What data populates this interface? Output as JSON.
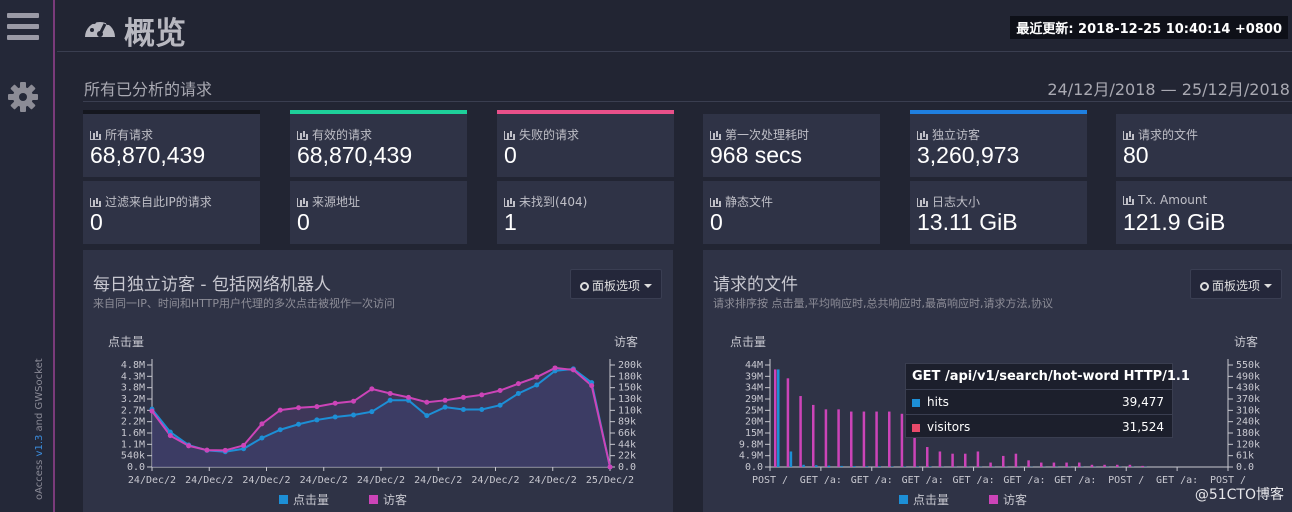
{
  "app": {
    "title": "概览",
    "last_updated": "最近更新: 2018-12-25 10:40:14 +0800"
  },
  "sidebar": {
    "credit_prefix": "oAccess",
    "credit_version": "v1.3",
    "credit_and": " and ",
    "credit_suffix": "GWSocket"
  },
  "overview": {
    "section_title": "所有已分析的请求",
    "date_range": "24/12月/2018 — 25/12月/2018"
  },
  "cards": [
    {
      "label": "所有请求",
      "value": "68,870,439"
    },
    {
      "label": "有效的请求",
      "value": "68,870,439"
    },
    {
      "label": "失败的请求",
      "value": "0"
    },
    {
      "label": "第一次处理耗时",
      "value": "968 secs"
    },
    {
      "label": "独立访客",
      "value": "3,260,973"
    },
    {
      "label": "请求的文件",
      "value": "80"
    },
    {
      "label": "过滤来自此IP的请求",
      "value": "0"
    },
    {
      "label": "来源地址",
      "value": "0"
    },
    {
      "label": "未找到(404)",
      "value": "1"
    },
    {
      "label": "静态文件",
      "value": "0"
    },
    {
      "label": "日志大小",
      "value": "13.11 GiB"
    },
    {
      "label": "Tx. Amount",
      "value": "121.9 GiB"
    }
  ],
  "colors": {
    "hits": "#1d8fd6",
    "visitors": "#cc44b8",
    "bar_green": "#1ecf9a",
    "bar_red": "#e8508a",
    "bar_blue": "#1f7fe0",
    "bar_dark": "#15171f"
  },
  "panel_left": {
    "title": "每日独立访客 - 包括网络机器人",
    "subtitle": "来自同一IP、时间和HTTP用户代理的多次点击被视作一次访问",
    "options_label": "面板选项",
    "y_left_title": "点击量",
    "y_right_title": "访客",
    "legend_hits": "点击量",
    "legend_visitors": "访客"
  },
  "panel_right": {
    "title": "请求的文件",
    "subtitle": "请求排序按 点击量,平均响应时,总共响应时,最高响应时,请求方法,协议",
    "options_label": "面板选项",
    "y_left_title": "点击量",
    "y_right_title": "访客",
    "legend_hits": "点击量",
    "legend_visitors": "访客"
  },
  "tooltip": {
    "title": "GET /api/v1/search/hot-word HTTP/1.1",
    "hits_label": "hits",
    "hits_value": "39,477",
    "visitors_label": "visitors",
    "visitors_value": "31,524"
  },
  "watermark": "@51CTO博客",
  "chart_data": [
    {
      "type": "line",
      "y_left_ticks": [
        "4.8M",
        "4.3M",
        "3.8M",
        "3.2M",
        "2.7M",
        "2.2M",
        "1.6M",
        "1.1M",
        "540k",
        "0.0"
      ],
      "y_right_ticks": [
        "200k",
        "180k",
        "150k",
        "130k",
        "110k",
        "89k",
        "66k",
        "44k",
        "22k",
        "0.0"
      ],
      "x_ticks": [
        "24/Dec/2",
        "24/Dec/2",
        "24/Dec/2",
        "24/Dec/2",
        "24/Dec/2",
        "24/Dec/2",
        "24/Dec/2",
        "24/Dec/2",
        "25/Dec/2"
      ],
      "series": [
        {
          "name": "点击量",
          "values": [
            2.95,
            1.78,
            1.12,
            0.85,
            0.78,
            0.93,
            1.48,
            1.9,
            2.18,
            2.4,
            2.55,
            2.65,
            2.82,
            3.4,
            3.4,
            2.62,
            3.05,
            2.93,
            2.93,
            3.15,
            3.75,
            4.18,
            4.9,
            5.0,
            4.3,
            0.0
          ]
        },
        {
          "name": "访客",
          "values": [
            2.85,
            1.6,
            1.08,
            0.86,
            0.85,
            1.1,
            2.2,
            2.9,
            3.02,
            3.08,
            3.25,
            3.35,
            3.98,
            3.75,
            3.55,
            3.3,
            3.4,
            3.55,
            3.68,
            3.9,
            4.25,
            4.58,
            5.05,
            4.95,
            4.15,
            0.0
          ]
        }
      ]
    },
    {
      "type": "bar",
      "y_left_ticks": [
        "44M",
        "39M",
        "34M",
        "29M",
        "25M",
        "20M",
        "15M",
        "9.8M",
        "4.9M",
        "0.0"
      ],
      "y_right_ticks": [
        "550k",
        "490k",
        "430k",
        "370k",
        "310k",
        "240k",
        "180k",
        "120k",
        "61k",
        "0.0"
      ],
      "x_ticks": [
        "POST /",
        "GET /a:",
        "GET /a:",
        "GET /a:",
        "GET /a:",
        "GET /a:",
        "GET /a:",
        "POST /",
        "GET /a:",
        "POST /"
      ],
      "series": [
        {
          "name": "点击量",
          "values": [
            44,
            7,
            1,
            0.8,
            0.6,
            0.5,
            0.4,
            0.3,
            0.3,
            0.2,
            0.2,
            0.2,
            0.2,
            0.1,
            0.1,
            0.1,
            0.1,
            0.1,
            0.1,
            0.1,
            0.1,
            0.1,
            0.1,
            0.1,
            0.1,
            0.1,
            0.1,
            0.1,
            0.1,
            0.1
          ]
        },
        {
          "name": "访客",
          "values": [
            44,
            40,
            32,
            28,
            26,
            26,
            25,
            25,
            25,
            25,
            24,
            24,
            9,
            7,
            6,
            6,
            7,
            2,
            5,
            6,
            3,
            2,
            2,
            2,
            2,
            1,
            1,
            1,
            1,
            0.5
          ]
        }
      ]
    }
  ]
}
